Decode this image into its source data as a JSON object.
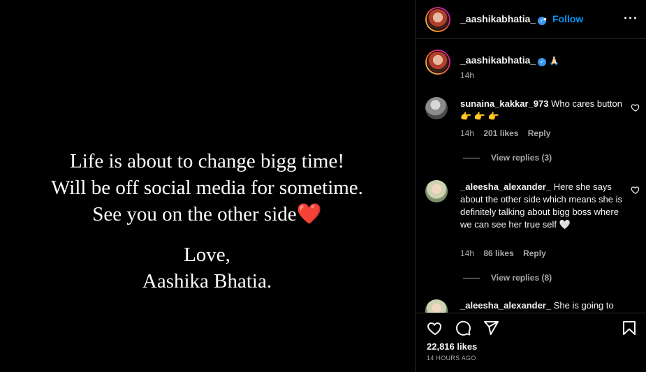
{
  "post": {
    "lines": [
      "Life is about to change bigg time!",
      "Will be off social media for sometime.",
      "See you on the other side"
    ],
    "heart_emoji": "❤️",
    "sign_off": "Love,",
    "signature": "Aashika Bhatia."
  },
  "header": {
    "username": "_aashikabhatia_",
    "separator": "•",
    "follow_label": "Follow",
    "more_label": "···"
  },
  "caption": {
    "username": "_aashikabhatia_",
    "emoji": "🙏🏻",
    "time": "14h"
  },
  "comments": [
    {
      "username": "sunaina_kakkar_973",
      "text": "Who cares button 👉 👉 👉",
      "time": "14h",
      "likes": "201 likes",
      "reply_label": "Reply",
      "view_replies": "View replies (3)"
    },
    {
      "username": "_aleesha_alexander_",
      "text": "Here she says about the other side which means she is definitely talking about bigg boss where we can see her true self 🤍",
      "time": "14h",
      "likes": "86 likes",
      "reply_label": "Reply",
      "view_replies": "View replies (8)"
    },
    {
      "username": "_aleesha_alexander_",
      "text": "She is going to"
    }
  ],
  "actions": {
    "likes_count": "22,816 likes",
    "posted_ago": "14 HOURS AGO"
  },
  "icons": {
    "verified": "verified-badge-icon",
    "like": "heart-icon",
    "comment": "comment-icon",
    "share": "share-icon",
    "save": "bookmark-icon"
  },
  "colors": {
    "accent": "#0095f6",
    "verified": "#3897f0",
    "heart_red": "#e0162b"
  }
}
